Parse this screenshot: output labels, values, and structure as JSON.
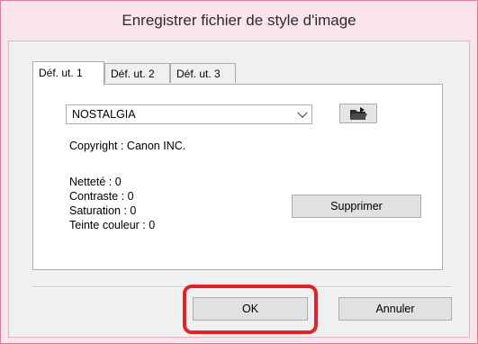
{
  "window": {
    "title": "Enregistrer fichier de style d'image"
  },
  "tabs": [
    {
      "label": "Déf. ut. 1",
      "active": true
    },
    {
      "label": "Déf. ut. 2",
      "active": false
    },
    {
      "label": "Déf. ut. 3",
      "active": false
    }
  ],
  "style_select": {
    "value": "NOSTALGIA"
  },
  "icons": {
    "open_folder": "open-folder-icon",
    "dropdown": "chevron-down-icon"
  },
  "copyright": "Copyright : Canon INC.",
  "params": {
    "sharpness": "Netteté : 0",
    "contrast": "Contraste : 0",
    "saturation": "Saturation : 0",
    "hue": "Teinte couleur : 0"
  },
  "buttons": {
    "delete": "Supprimer",
    "ok": "OK",
    "cancel": "Annuler"
  },
  "colors": {
    "title_bar": "#fbe5ec",
    "highlight": "#e0242c"
  }
}
